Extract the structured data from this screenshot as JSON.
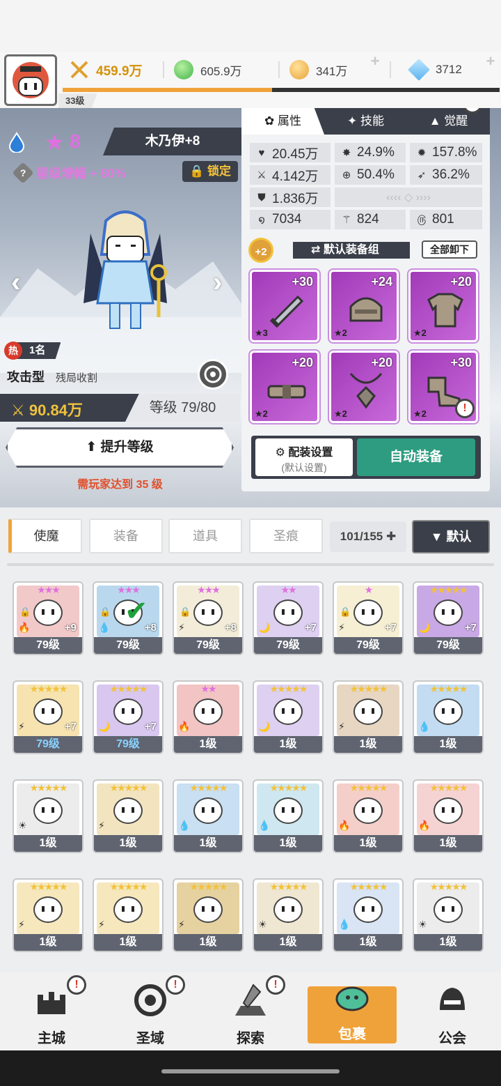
{
  "header": {
    "level": "33级",
    "power": "459.9万",
    "gems_green": "605.9万",
    "gold": "341万",
    "crystals": "3712",
    "xp_fraction": 0.48
  },
  "hero": {
    "star_count": "8",
    "name": "木乃伊+8",
    "star_boost": "星级增幅 + 80%",
    "lock_label": "锁定",
    "rank_prefix": "热",
    "rank": "1名",
    "type": "攻击型",
    "subtype": "残局收割",
    "power": "90.84万",
    "level": "等级 79/80",
    "upgrade_label": "提升等级",
    "requirement": "需玩家达到 35 级"
  },
  "card": {
    "tabs": [
      "属性",
      "技能",
      "觉醒"
    ],
    "stats": {
      "hp": "20.45万",
      "crit": "24.9%",
      "crit_dmg": "157.8%",
      "atk": "4.142万",
      "accuracy": "50.4%",
      "speed": "36.2%",
      "def": "1.836万",
      "stat_a": "7034",
      "stat_b": "824",
      "stat_c": "801"
    },
    "equip_bonus": "+2",
    "set_name": "默认装备组",
    "unequip_label": "全部卸下",
    "equipment": [
      {
        "plus": "+30",
        "stars": "★3",
        "icon": "sword-icon"
      },
      {
        "plus": "+24",
        "stars": "★2",
        "icon": "helmet-icon"
      },
      {
        "plus": "+20",
        "stars": "★2",
        "icon": "armor-icon"
      },
      {
        "plus": "+20",
        "stars": "★2",
        "icon": "belt-icon"
      },
      {
        "plus": "+20",
        "stars": "★2",
        "icon": "necklace-icon"
      },
      {
        "plus": "+30",
        "stars": "★2",
        "icon": "boots-icon"
      }
    ],
    "config_label": "配装设置",
    "config_sub": "(默认设置)",
    "auto_label": "自动装备"
  },
  "inventory_tabs": [
    "使魔",
    "装备",
    "道具",
    "圣痕"
  ],
  "count": "101/155",
  "sort_label": "▼ 默认",
  "heroes": [
    {
      "level": "79级",
      "stars": "★★★",
      "star_color": "#e070e0",
      "bg": "#f2c9c9",
      "elem": "🔥",
      "plus": "+9",
      "locked": true
    },
    {
      "level": "79级",
      "stars": "★★★",
      "star_color": "#e070e0",
      "bg": "#b9d8ee",
      "elem": "💧",
      "plus": "+8",
      "locked": true,
      "checked": true
    },
    {
      "level": "79级",
      "stars": "★★★",
      "star_color": "#e070e0",
      "bg": "#f3ecd9",
      "elem": "⚡",
      "plus": "+8",
      "locked": true
    },
    {
      "level": "79级",
      "stars": "★★",
      "star_color": "#e070e0",
      "bg": "#ddd0f0",
      "elem": "🌙",
      "plus": "+7"
    },
    {
      "level": "79级",
      "stars": "★",
      "star_color": "#e070e0",
      "bg": "#f6efd4",
      "elem": "⚡",
      "plus": "+7",
      "locked": true
    },
    {
      "level": "79级",
      "stars": "★★★★★",
      "star_color": "#f1c23a",
      "bg": "#c9a8e6",
      "elem": "🌙",
      "plus": "+7"
    },
    {
      "level": "79级",
      "stars": "★★★★★",
      "star_color": "#f1c23a",
      "bg": "#f6e3b0",
      "elem": "⚡",
      "plus": "+7",
      "blue": true
    },
    {
      "level": "79级",
      "stars": "★★★★★",
      "star_color": "#f1c23a",
      "bg": "#d9c7f0",
      "elem": "🌙",
      "plus": "+7",
      "blue": true
    },
    {
      "level": "1级",
      "stars": "★★",
      "star_color": "#e070e0",
      "bg": "#f2c4c4",
      "elem": "🔥"
    },
    {
      "level": "1级",
      "stars": "★★★★★",
      "star_color": "#f1c23a",
      "bg": "#ddd0f0",
      "elem": "🌙"
    },
    {
      "level": "1级",
      "stars": "★★★★★",
      "star_color": "#f1c23a",
      "bg": "#e7d6c2",
      "elem": "⚡"
    },
    {
      "level": "1级",
      "stars": "★★★★★",
      "star_color": "#f1c23a",
      "bg": "#c3dcf2",
      "elem": "💧"
    },
    {
      "level": "1级",
      "stars": "★★★★★",
      "star_color": "#f1c23a",
      "bg": "#ececec",
      "elem": "☀"
    },
    {
      "level": "1级",
      "stars": "★★★★★",
      "star_color": "#f1c23a",
      "bg": "#f3e4c0",
      "elem": "⚡"
    },
    {
      "level": "1级",
      "stars": "★★★★★",
      "star_color": "#f1c23a",
      "bg": "#c9dff2",
      "elem": "💧"
    },
    {
      "level": "1级",
      "stars": "★★★★★",
      "star_color": "#f1c23a",
      "bg": "#cfe7f0",
      "elem": "💧"
    },
    {
      "level": "1级",
      "stars": "★★★★★",
      "star_color": "#f1c23a",
      "bg": "#f4cfc9",
      "elem": "🔥"
    },
    {
      "level": "1级",
      "stars": "★★★★★",
      "star_color": "#f1c23a",
      "bg": "#f6d3d3",
      "elem": "🔥"
    },
    {
      "level": "1级",
      "stars": "★★★★★",
      "star_color": "#f1c23a",
      "bg": "#f6e7bd",
      "elem": "⚡"
    },
    {
      "level": "1级",
      "stars": "★★★★★",
      "star_color": "#f1c23a",
      "bg": "#f6e7bd",
      "elem": "⚡"
    },
    {
      "level": "1级",
      "stars": "★★★★★",
      "star_color": "#f1c23a",
      "bg": "#e6d2a0",
      "elem": "⚡"
    },
    {
      "level": "1级",
      "stars": "★★★★★",
      "star_color": "#f1c23a",
      "bg": "#efe7d2",
      "elem": "☀"
    },
    {
      "level": "1级",
      "stars": "★★★★★",
      "star_color": "#f1c23a",
      "bg": "#d9e4f4",
      "elem": "💧"
    },
    {
      "level": "1级",
      "stars": "★★★★★",
      "star_color": "#f1c23a",
      "bg": "#ececec",
      "elem": "☀"
    }
  ],
  "nav": [
    {
      "label": "主城",
      "icon": "castle-icon",
      "alert": true
    },
    {
      "label": "圣域",
      "icon": "portal-icon",
      "alert": true
    },
    {
      "label": "探索",
      "icon": "sword-stone-icon",
      "alert": true
    },
    {
      "label": "包裹",
      "icon": "bag-icon",
      "active": true
    },
    {
      "label": "公会",
      "icon": "guild-helmet-icon"
    }
  ],
  "colors": {
    "accent": "#f0a23a",
    "dark_panel": "#3a3f4a",
    "equip_purple": "#b04bc8",
    "auto_green": "#2d9c80"
  }
}
